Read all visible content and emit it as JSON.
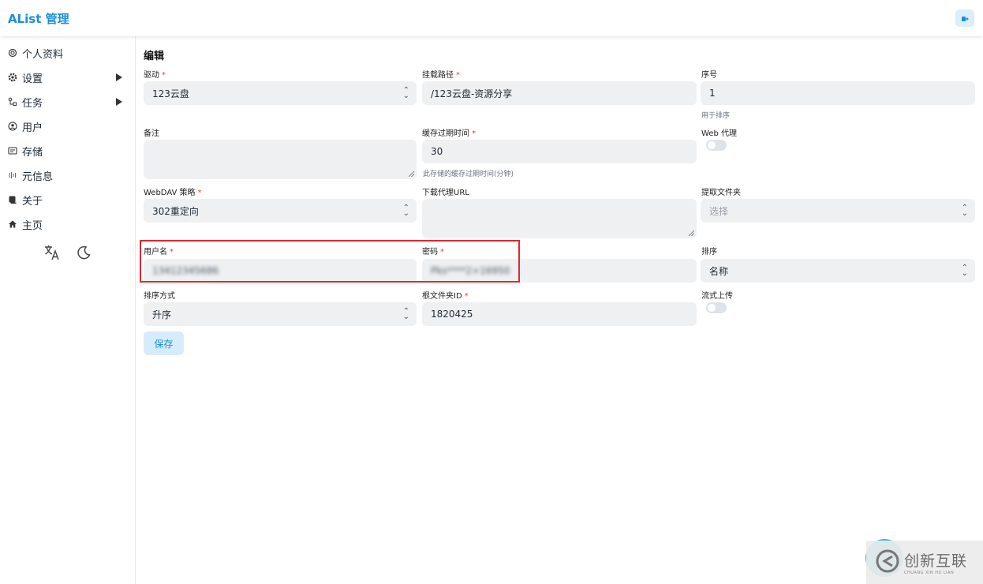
{
  "header": {
    "brand": "AList 管理",
    "logout_icon": "logout-icon"
  },
  "sidebar": {
    "items": [
      {
        "label": "个人资料",
        "icon": "fingerprint-icon",
        "has_submenu": false
      },
      {
        "label": "设置",
        "icon": "gear-icon",
        "has_submenu": true
      },
      {
        "label": "任务",
        "icon": "task-flow-icon",
        "has_submenu": true
      },
      {
        "label": "用户",
        "icon": "user-circle-icon",
        "has_submenu": false
      },
      {
        "label": "存储",
        "icon": "storage-icon",
        "has_submenu": false
      },
      {
        "label": "元信息",
        "icon": "meta-icon",
        "has_submenu": false
      },
      {
        "label": "关于",
        "icon": "info-icon",
        "has_submenu": false
      },
      {
        "label": "主页",
        "icon": "home-icon",
        "has_submenu": false
      }
    ],
    "tools": {
      "language_icon": "translate-icon",
      "theme_icon": "moon-icon"
    }
  },
  "form": {
    "title": "编辑",
    "driver": {
      "label": "驱动",
      "required": "*",
      "value": "123云盘"
    },
    "mount_path": {
      "label": "挂载路径",
      "required": "*",
      "value": "/123云盘-资源分享"
    },
    "order": {
      "label": "序号",
      "value": "1",
      "hint": "用于排序"
    },
    "remark": {
      "label": "备注",
      "value": ""
    },
    "cache_expiration": {
      "label": "缓存过期时间",
      "required": "*",
      "value": "30",
      "hint": "此存储的缓存过期时间(分钟)"
    },
    "web_proxy": {
      "label": "Web 代理",
      "enabled": false
    },
    "webdav_policy": {
      "label": "WebDAV 策略",
      "required": "*",
      "value": "302重定向"
    },
    "download_proxy_url": {
      "label": "下载代理URL",
      "value": ""
    },
    "extract_folder": {
      "label": "提取文件夹",
      "placeholder": "选择"
    },
    "username": {
      "label": "用户名",
      "required": "*",
      "value": "13412345686"
    },
    "password": {
      "label": "密码",
      "required": "*",
      "value": "Pks****2+16950"
    },
    "sort": {
      "label": "排序",
      "value": "名称"
    },
    "sort_direction": {
      "label": "排序方式",
      "value": "升序"
    },
    "root_folder_id": {
      "label": "根文件夹ID",
      "required": "*",
      "value": "1820425"
    },
    "stream_upload": {
      "label": "流式上传",
      "enabled": false
    },
    "save_label": "保存"
  },
  "watermark": {
    "text": "创新互联",
    "subtext": "CHUANG XIN HU LIAN"
  },
  "colors": {
    "brand": "#1a8fd8",
    "highlight": "#e0282e",
    "required": "#e53e3e"
  }
}
